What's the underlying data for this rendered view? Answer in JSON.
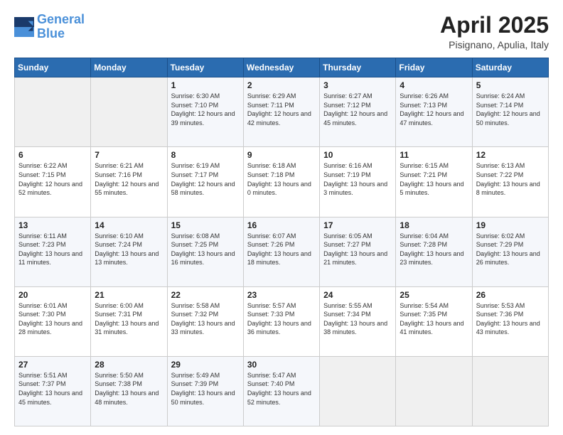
{
  "logo": {
    "text_general": "General",
    "text_blue": "Blue"
  },
  "title": "April 2025",
  "location": "Pisignano, Apulia, Italy",
  "days_of_week": [
    "Sunday",
    "Monday",
    "Tuesday",
    "Wednesday",
    "Thursday",
    "Friday",
    "Saturday"
  ],
  "weeks": [
    [
      {
        "day": "",
        "info": ""
      },
      {
        "day": "",
        "info": ""
      },
      {
        "day": "1",
        "info": "Sunrise: 6:30 AM\nSunset: 7:10 PM\nDaylight: 12 hours and 39 minutes."
      },
      {
        "day": "2",
        "info": "Sunrise: 6:29 AM\nSunset: 7:11 PM\nDaylight: 12 hours and 42 minutes."
      },
      {
        "day": "3",
        "info": "Sunrise: 6:27 AM\nSunset: 7:12 PM\nDaylight: 12 hours and 45 minutes."
      },
      {
        "day": "4",
        "info": "Sunrise: 6:26 AM\nSunset: 7:13 PM\nDaylight: 12 hours and 47 minutes."
      },
      {
        "day": "5",
        "info": "Sunrise: 6:24 AM\nSunset: 7:14 PM\nDaylight: 12 hours and 50 minutes."
      }
    ],
    [
      {
        "day": "6",
        "info": "Sunrise: 6:22 AM\nSunset: 7:15 PM\nDaylight: 12 hours and 52 minutes."
      },
      {
        "day": "7",
        "info": "Sunrise: 6:21 AM\nSunset: 7:16 PM\nDaylight: 12 hours and 55 minutes."
      },
      {
        "day": "8",
        "info": "Sunrise: 6:19 AM\nSunset: 7:17 PM\nDaylight: 12 hours and 58 minutes."
      },
      {
        "day": "9",
        "info": "Sunrise: 6:18 AM\nSunset: 7:18 PM\nDaylight: 13 hours and 0 minutes."
      },
      {
        "day": "10",
        "info": "Sunrise: 6:16 AM\nSunset: 7:19 PM\nDaylight: 13 hours and 3 minutes."
      },
      {
        "day": "11",
        "info": "Sunrise: 6:15 AM\nSunset: 7:21 PM\nDaylight: 13 hours and 5 minutes."
      },
      {
        "day": "12",
        "info": "Sunrise: 6:13 AM\nSunset: 7:22 PM\nDaylight: 13 hours and 8 minutes."
      }
    ],
    [
      {
        "day": "13",
        "info": "Sunrise: 6:11 AM\nSunset: 7:23 PM\nDaylight: 13 hours and 11 minutes."
      },
      {
        "day": "14",
        "info": "Sunrise: 6:10 AM\nSunset: 7:24 PM\nDaylight: 13 hours and 13 minutes."
      },
      {
        "day": "15",
        "info": "Sunrise: 6:08 AM\nSunset: 7:25 PM\nDaylight: 13 hours and 16 minutes."
      },
      {
        "day": "16",
        "info": "Sunrise: 6:07 AM\nSunset: 7:26 PM\nDaylight: 13 hours and 18 minutes."
      },
      {
        "day": "17",
        "info": "Sunrise: 6:05 AM\nSunset: 7:27 PM\nDaylight: 13 hours and 21 minutes."
      },
      {
        "day": "18",
        "info": "Sunrise: 6:04 AM\nSunset: 7:28 PM\nDaylight: 13 hours and 23 minutes."
      },
      {
        "day": "19",
        "info": "Sunrise: 6:02 AM\nSunset: 7:29 PM\nDaylight: 13 hours and 26 minutes."
      }
    ],
    [
      {
        "day": "20",
        "info": "Sunrise: 6:01 AM\nSunset: 7:30 PM\nDaylight: 13 hours and 28 minutes."
      },
      {
        "day": "21",
        "info": "Sunrise: 6:00 AM\nSunset: 7:31 PM\nDaylight: 13 hours and 31 minutes."
      },
      {
        "day": "22",
        "info": "Sunrise: 5:58 AM\nSunset: 7:32 PM\nDaylight: 13 hours and 33 minutes."
      },
      {
        "day": "23",
        "info": "Sunrise: 5:57 AM\nSunset: 7:33 PM\nDaylight: 13 hours and 36 minutes."
      },
      {
        "day": "24",
        "info": "Sunrise: 5:55 AM\nSunset: 7:34 PM\nDaylight: 13 hours and 38 minutes."
      },
      {
        "day": "25",
        "info": "Sunrise: 5:54 AM\nSunset: 7:35 PM\nDaylight: 13 hours and 41 minutes."
      },
      {
        "day": "26",
        "info": "Sunrise: 5:53 AM\nSunset: 7:36 PM\nDaylight: 13 hours and 43 minutes."
      }
    ],
    [
      {
        "day": "27",
        "info": "Sunrise: 5:51 AM\nSunset: 7:37 PM\nDaylight: 13 hours and 45 minutes."
      },
      {
        "day": "28",
        "info": "Sunrise: 5:50 AM\nSunset: 7:38 PM\nDaylight: 13 hours and 48 minutes."
      },
      {
        "day": "29",
        "info": "Sunrise: 5:49 AM\nSunset: 7:39 PM\nDaylight: 13 hours and 50 minutes."
      },
      {
        "day": "30",
        "info": "Sunrise: 5:47 AM\nSunset: 7:40 PM\nDaylight: 13 hours and 52 minutes."
      },
      {
        "day": "",
        "info": ""
      },
      {
        "day": "",
        "info": ""
      },
      {
        "day": "",
        "info": ""
      }
    ]
  ]
}
